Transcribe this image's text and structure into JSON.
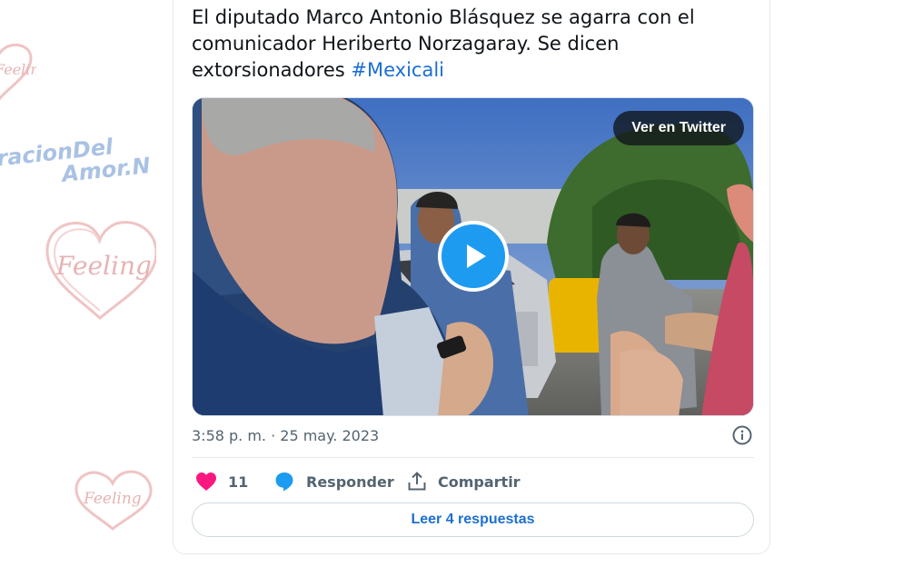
{
  "background": {
    "watermark_texts": [
      "racionDel",
      "Amor.N"
    ],
    "heart_labels": [
      "Feeling",
      "Feeling",
      "Feeling"
    ]
  },
  "tweet": {
    "text": "El diputado Marco Antonio Blásquez se agarra con el comunicador Heriberto Norzagaray.  Se dicen extorsionadores ",
    "hashtag": "#Mexicali",
    "timestamp": "3:58 p. m. · 25 may. 2023",
    "media": {
      "watch_label": "Ver en Twitter",
      "play_icon": "play-icon"
    },
    "actions": {
      "like_count": "11",
      "reply_label": "Responder",
      "share_label": "Compartir"
    },
    "replies_label": "Leer 4 respuestas"
  },
  "colors": {
    "accent": "#1d9bf0",
    "link": "#1d6fd1",
    "like": "#f91880",
    "muted": "#536471"
  }
}
